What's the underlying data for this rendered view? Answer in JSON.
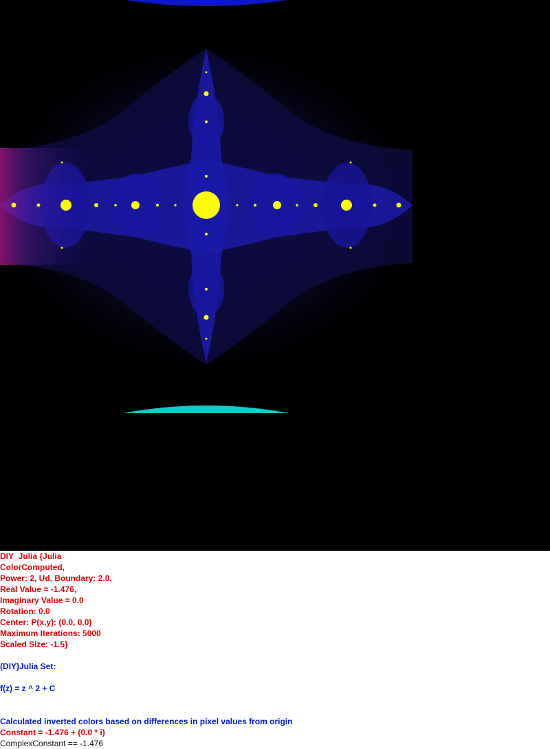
{
  "colors": {
    "background": "#000000",
    "caption_background": "#ffffff",
    "fractal_body": "#1a1aa8",
    "fractal_glow": "#0a0a3a",
    "fractal_halo": "#0c0a2a",
    "bulb_fill": "#ffff00",
    "left_tint": "#c21a8a",
    "top_arc": "#0a18c8",
    "bottom_arc": "#18c8c8",
    "red_text": "#e00000",
    "blue_text": "#0018d8",
    "dark_text": "#111111"
  },
  "caption": {
    "params": [
      "DIY_Julia {Julia",
      "ColorComputed,",
      "Power: 2, Ud, Boundary: 2.0,",
      "Real Value = -1.476,",
      "Imaginary Value = 0.0",
      "Rotation: 0.0",
      "Center: P(x,y): (0.0, 0.0)",
      "Maximum Iterations: 5000",
      "Scaled Size: -1.5}"
    ],
    "set_name": "(DIY)Julia Set:",
    "formula": "f(z) = z ^ 2 + C",
    "description": "Calculated inverted colors based on differences in pixel values from origin",
    "constant": "Constant = -1.476 + (0.0 * i)",
    "complex_constant": "ComplexConstant == -1.476"
  }
}
